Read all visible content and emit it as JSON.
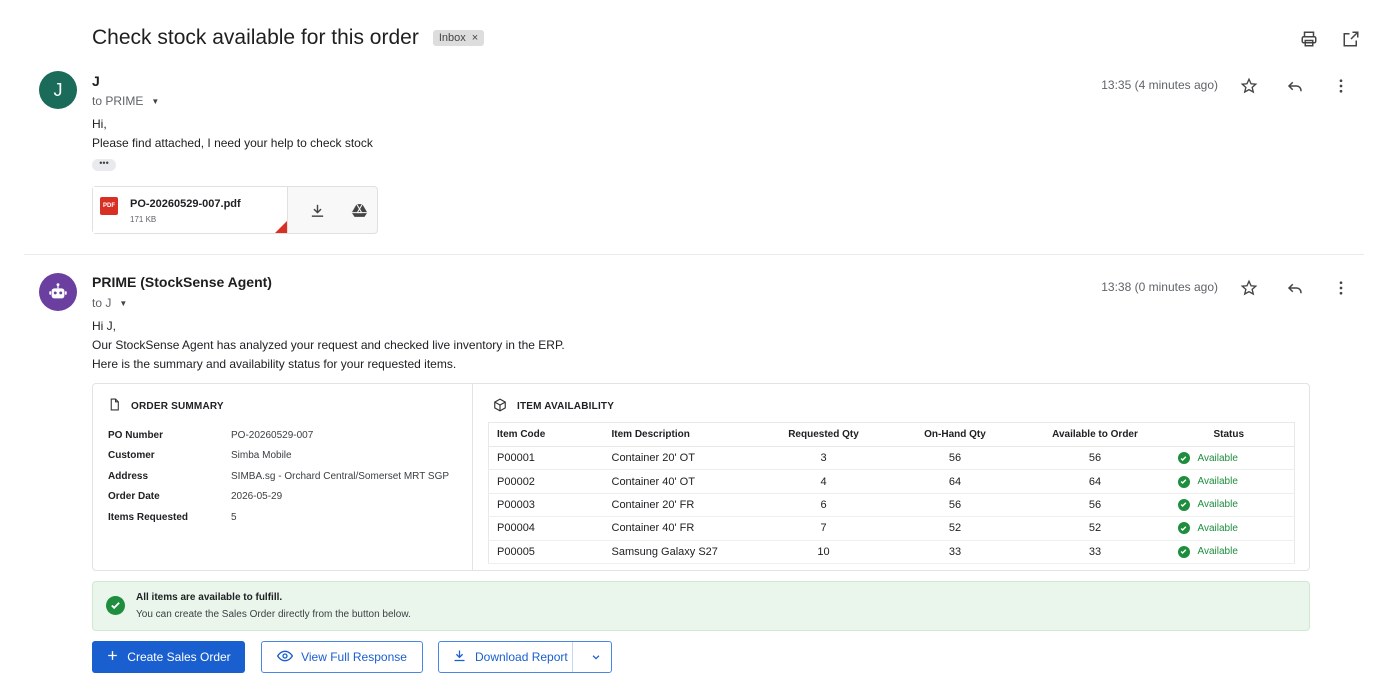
{
  "subject": "Check stock available for this order",
  "label": {
    "text": "Inbox",
    "remove": "×"
  },
  "toolbar_icons": [
    "print-icon",
    "open-in-new-window-icon"
  ],
  "messages": [
    {
      "avatar": "J",
      "avatar_color": "#1a6b5a",
      "sender": "J",
      "to": "to PRIME",
      "time": "13:35 (4 minutes ago)",
      "body": [
        "Hi,",
        "Please find attached, I need your help to check stock"
      ],
      "trimmed": "•••",
      "attachment": {
        "badge": "PDF",
        "name": "PO-20260529-007.pdf",
        "size": "171 KB"
      }
    },
    {
      "avatar_icon": "robot-icon",
      "avatar_color": "#6b3fa0",
      "sender": "PRIME (StockSense Agent)",
      "to": "to J",
      "time": "13:38 (0 minutes ago)",
      "body": [
        "Hi J,",
        "Our StockSense Agent has analyzed your request and checked live inventory in the ERP.",
        "Here is the summary and availability status for your requested items."
      ]
    }
  ],
  "order_summary": {
    "title": "ORDER SUMMARY",
    "fields": [
      {
        "k": "PO Number",
        "v": "PO-20260529-007"
      },
      {
        "k": "Customer",
        "v": "Simba Mobile"
      },
      {
        "k": "Address",
        "v": "SIMBA.sg - Orchard Central/Somerset MRT SGP"
      },
      {
        "k": "Order Date",
        "v": "2026-05-29"
      },
      {
        "k": "Items Requested",
        "v": "5"
      }
    ]
  },
  "item_availability": {
    "title": "ITEM AVAILABILITY",
    "columns": [
      "Item Code",
      "Item Description",
      "Requested Qty",
      "On-Hand Qty",
      "Available to Order",
      "Status"
    ],
    "rows": [
      [
        "P00001",
        "Container 20' OT",
        "3",
        "56",
        "56",
        "Available"
      ],
      [
        "P00002",
        "Container 40' OT",
        "4",
        "64",
        "64",
        "Available"
      ],
      [
        "P00003",
        "Container 20' FR",
        "6",
        "56",
        "56",
        "Available"
      ],
      [
        "P00004",
        "Container 40' FR",
        "7",
        "52",
        "52",
        "Available"
      ],
      [
        "P00005",
        "Samsung Galaxy S27",
        "10",
        "33",
        "33",
        "Available"
      ]
    ]
  },
  "banner": {
    "title": "All items are available to fulfill.",
    "text": "You can create the Sales Order directly from the button below."
  },
  "buttons": {
    "create": "Create Sales Order",
    "view": "View Full Response",
    "download": "Download Report"
  },
  "colors": {
    "primary": "#1a5fd0",
    "success": "#1e8e3e",
    "banner_bg": "#eaf6ec"
  }
}
